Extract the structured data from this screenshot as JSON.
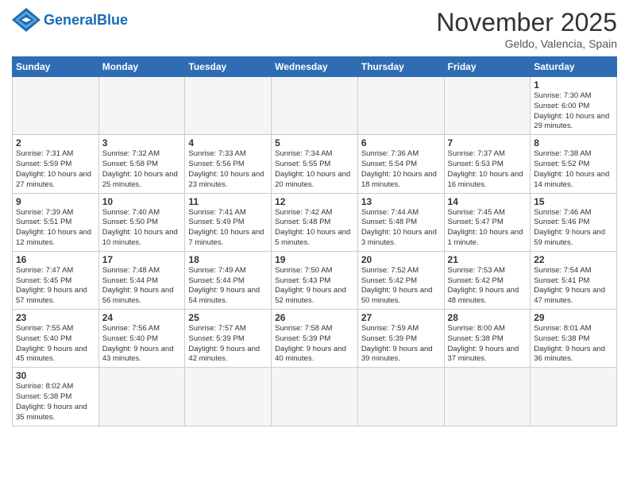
{
  "logo": {
    "text_general": "General",
    "text_blue": "Blue"
  },
  "header": {
    "month_year": "November 2025",
    "location": "Geldo, Valencia, Spain"
  },
  "weekdays": [
    "Sunday",
    "Monday",
    "Tuesday",
    "Wednesday",
    "Thursday",
    "Friday",
    "Saturday"
  ],
  "weeks": [
    [
      {
        "day": "",
        "info": ""
      },
      {
        "day": "",
        "info": ""
      },
      {
        "day": "",
        "info": ""
      },
      {
        "day": "",
        "info": ""
      },
      {
        "day": "",
        "info": ""
      },
      {
        "day": "",
        "info": ""
      },
      {
        "day": "1",
        "info": "Sunrise: 7:30 AM\nSunset: 6:00 PM\nDaylight: 10 hours and 29 minutes."
      }
    ],
    [
      {
        "day": "2",
        "info": "Sunrise: 7:31 AM\nSunset: 5:59 PM\nDaylight: 10 hours and 27 minutes."
      },
      {
        "day": "3",
        "info": "Sunrise: 7:32 AM\nSunset: 5:58 PM\nDaylight: 10 hours and 25 minutes."
      },
      {
        "day": "4",
        "info": "Sunrise: 7:33 AM\nSunset: 5:56 PM\nDaylight: 10 hours and 23 minutes."
      },
      {
        "day": "5",
        "info": "Sunrise: 7:34 AM\nSunset: 5:55 PM\nDaylight: 10 hours and 20 minutes."
      },
      {
        "day": "6",
        "info": "Sunrise: 7:36 AM\nSunset: 5:54 PM\nDaylight: 10 hours and 18 minutes."
      },
      {
        "day": "7",
        "info": "Sunrise: 7:37 AM\nSunset: 5:53 PM\nDaylight: 10 hours and 16 minutes."
      },
      {
        "day": "8",
        "info": "Sunrise: 7:38 AM\nSunset: 5:52 PM\nDaylight: 10 hours and 14 minutes."
      }
    ],
    [
      {
        "day": "9",
        "info": "Sunrise: 7:39 AM\nSunset: 5:51 PM\nDaylight: 10 hours and 12 minutes."
      },
      {
        "day": "10",
        "info": "Sunrise: 7:40 AM\nSunset: 5:50 PM\nDaylight: 10 hours and 10 minutes."
      },
      {
        "day": "11",
        "info": "Sunrise: 7:41 AM\nSunset: 5:49 PM\nDaylight: 10 hours and 7 minutes."
      },
      {
        "day": "12",
        "info": "Sunrise: 7:42 AM\nSunset: 5:48 PM\nDaylight: 10 hours and 5 minutes."
      },
      {
        "day": "13",
        "info": "Sunrise: 7:44 AM\nSunset: 5:48 PM\nDaylight: 10 hours and 3 minutes."
      },
      {
        "day": "14",
        "info": "Sunrise: 7:45 AM\nSunset: 5:47 PM\nDaylight: 10 hours and 1 minute."
      },
      {
        "day": "15",
        "info": "Sunrise: 7:46 AM\nSunset: 5:46 PM\nDaylight: 9 hours and 59 minutes."
      }
    ],
    [
      {
        "day": "16",
        "info": "Sunrise: 7:47 AM\nSunset: 5:45 PM\nDaylight: 9 hours and 57 minutes."
      },
      {
        "day": "17",
        "info": "Sunrise: 7:48 AM\nSunset: 5:44 PM\nDaylight: 9 hours and 56 minutes."
      },
      {
        "day": "18",
        "info": "Sunrise: 7:49 AM\nSunset: 5:44 PM\nDaylight: 9 hours and 54 minutes."
      },
      {
        "day": "19",
        "info": "Sunrise: 7:50 AM\nSunset: 5:43 PM\nDaylight: 9 hours and 52 minutes."
      },
      {
        "day": "20",
        "info": "Sunrise: 7:52 AM\nSunset: 5:42 PM\nDaylight: 9 hours and 50 minutes."
      },
      {
        "day": "21",
        "info": "Sunrise: 7:53 AM\nSunset: 5:42 PM\nDaylight: 9 hours and 48 minutes."
      },
      {
        "day": "22",
        "info": "Sunrise: 7:54 AM\nSunset: 5:41 PM\nDaylight: 9 hours and 47 minutes."
      }
    ],
    [
      {
        "day": "23",
        "info": "Sunrise: 7:55 AM\nSunset: 5:40 PM\nDaylight: 9 hours and 45 minutes."
      },
      {
        "day": "24",
        "info": "Sunrise: 7:56 AM\nSunset: 5:40 PM\nDaylight: 9 hours and 43 minutes."
      },
      {
        "day": "25",
        "info": "Sunrise: 7:57 AM\nSunset: 5:39 PM\nDaylight: 9 hours and 42 minutes."
      },
      {
        "day": "26",
        "info": "Sunrise: 7:58 AM\nSunset: 5:39 PM\nDaylight: 9 hours and 40 minutes."
      },
      {
        "day": "27",
        "info": "Sunrise: 7:59 AM\nSunset: 5:39 PM\nDaylight: 9 hours and 39 minutes."
      },
      {
        "day": "28",
        "info": "Sunrise: 8:00 AM\nSunset: 5:38 PM\nDaylight: 9 hours and 37 minutes."
      },
      {
        "day": "29",
        "info": "Sunrise: 8:01 AM\nSunset: 5:38 PM\nDaylight: 9 hours and 36 minutes."
      }
    ],
    [
      {
        "day": "30",
        "info": "Sunrise: 8:02 AM\nSunset: 5:38 PM\nDaylight: 9 hours and 35 minutes."
      },
      {
        "day": "",
        "info": ""
      },
      {
        "day": "",
        "info": ""
      },
      {
        "day": "",
        "info": ""
      },
      {
        "day": "",
        "info": ""
      },
      {
        "day": "",
        "info": ""
      },
      {
        "day": "",
        "info": ""
      }
    ]
  ]
}
